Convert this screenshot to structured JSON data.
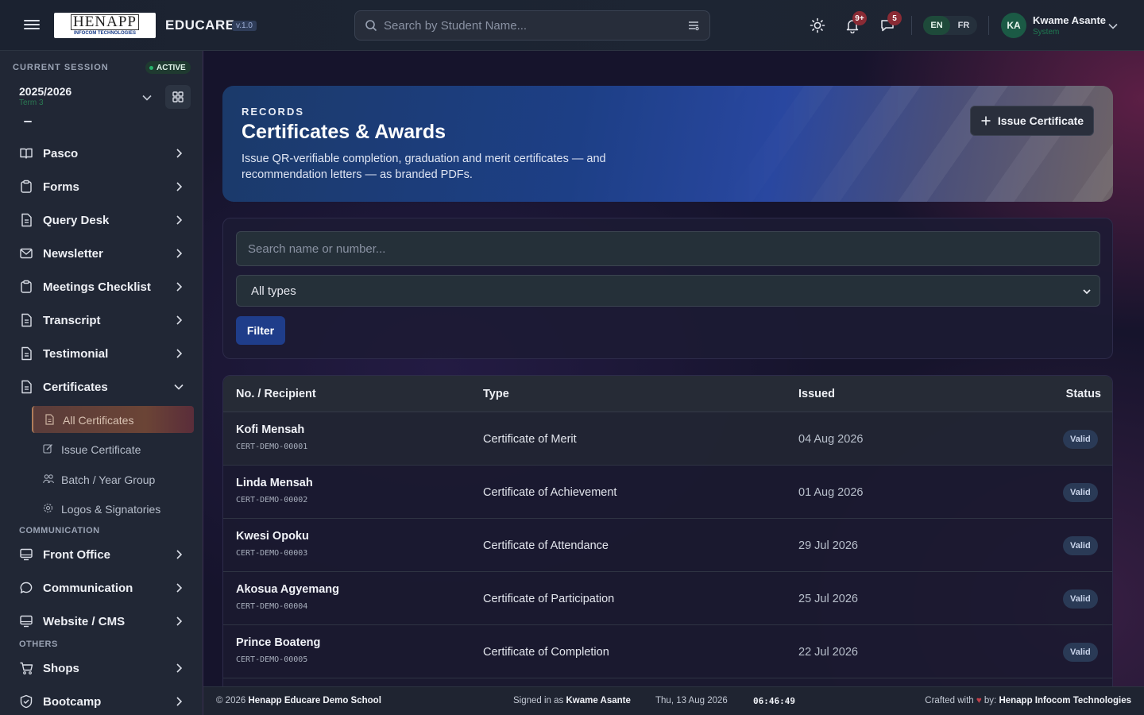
{
  "brand": {
    "logo_main": "HENAPP",
    "logo_sub": "INFOCOM TECHNOLOGIES",
    "name": "EDUCARE",
    "version": "v.1.0"
  },
  "topbar": {
    "search_placeholder": "Search by Student Name...",
    "notifications_count": "9+",
    "messages_count": "5",
    "languages": [
      "EN",
      "FR"
    ],
    "active_language": "EN",
    "user": {
      "initials": "KA",
      "name": "Kwame Asante",
      "role": "System"
    }
  },
  "session": {
    "label": "CURRENT SESSION",
    "status": "ACTIVE",
    "year": "2025/2026",
    "term": "Term 3"
  },
  "sidebar": {
    "items": [
      {
        "label": "Pasco",
        "icon": "book-icon"
      },
      {
        "label": "Forms",
        "icon": "clipboard-icon"
      },
      {
        "label": "Query Desk",
        "icon": "document-icon"
      },
      {
        "label": "Newsletter",
        "icon": "mail-icon"
      },
      {
        "label": "Meetings Checklist",
        "icon": "clipboard-icon"
      },
      {
        "label": "Transcript",
        "icon": "document-icon"
      },
      {
        "label": "Testimonial",
        "icon": "document-icon"
      },
      {
        "label": "Certificates",
        "icon": "document-icon",
        "expanded": true
      }
    ],
    "certificates_sub": [
      {
        "label": "All Certificates",
        "icon": "document-icon",
        "active": true
      },
      {
        "label": "Issue Certificate",
        "icon": "edit-icon"
      },
      {
        "label": "Batch / Year Group",
        "icon": "group-icon"
      },
      {
        "label": "Logos & Signatories",
        "icon": "gear-icon"
      }
    ],
    "communication_label": "COMMUNICATION",
    "communication_items": [
      {
        "label": "Front Office",
        "icon": "monitor-icon"
      },
      {
        "label": "Communication",
        "icon": "chat-icon"
      },
      {
        "label": "Website / CMS",
        "icon": "monitor-icon"
      }
    ],
    "others_label": "OTHERS",
    "others_items": [
      {
        "label": "Shops",
        "icon": "cart-icon"
      },
      {
        "label": "Bootcamp",
        "icon": "shield-icon"
      }
    ]
  },
  "hero": {
    "kicker": "RECORDS",
    "title": "Certificates & Awards",
    "description": "Issue QR-verifiable completion, graduation and merit certificates — and recommendation letters — as branded PDFs.",
    "issue_button": "Issue Certificate"
  },
  "filters": {
    "search_placeholder": "Search name or number...",
    "type_selected": "All types",
    "filter_button": "Filter"
  },
  "table": {
    "headers": [
      "No. / Recipient",
      "Type",
      "Issued",
      "Status"
    ],
    "rows": [
      {
        "name": "Kofi Mensah",
        "number": "CERT-DEMO-00001",
        "type": "Certificate of Merit",
        "issued": "04 Aug 2026",
        "status": "Valid"
      },
      {
        "name": "Linda Mensah",
        "number": "CERT-DEMO-00002",
        "type": "Certificate of Achievement",
        "issued": "01 Aug 2026",
        "status": "Valid"
      },
      {
        "name": "Kwesi Opoku",
        "number": "CERT-DEMO-00003",
        "type": "Certificate of Attendance",
        "issued": "29 Jul 2026",
        "status": "Valid"
      },
      {
        "name": "Akosua Agyemang",
        "number": "CERT-DEMO-00004",
        "type": "Certificate of Participation",
        "issued": "25 Jul 2026",
        "status": "Valid"
      },
      {
        "name": "Prince Boateng",
        "number": "CERT-DEMO-00005",
        "type": "Certificate of Completion",
        "issued": "22 Jul 2026",
        "status": "Valid"
      }
    ]
  },
  "footer": {
    "copyright_prefix": "© 2026",
    "school": "Henapp Educare Demo School",
    "signed_in_prefix": "Signed in as",
    "signed_in_user": "Kwame Asante",
    "date": "Thu, 13 Aug 2026",
    "time": "06:46:49",
    "crafted_prefix": "Crafted with",
    "crafted_by": "by:",
    "company": "Henapp Infocom Technologies"
  },
  "colors": {
    "accent_blue": "#1f3d8a",
    "active_session_green": "#27b36c",
    "status_badge_bg": "#2a3a56",
    "notification_badge": "#8a2b35"
  }
}
